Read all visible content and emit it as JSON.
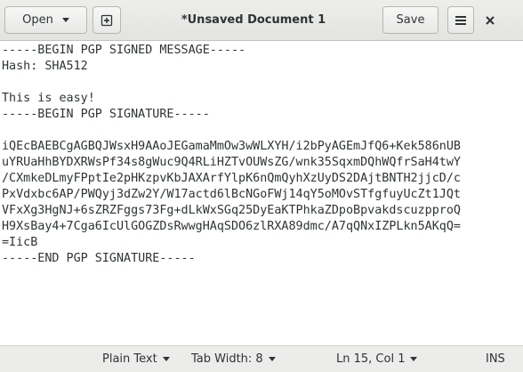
{
  "header": {
    "open_label": "Open",
    "title": "*Unsaved Document 1",
    "save_label": "Save",
    "icons": {
      "new": "new-document-icon",
      "menu": "hamburger-menu-icon",
      "close": "close-icon",
      "dropdown": "chevron-down-icon"
    }
  },
  "editor": {
    "lines": [
      "-----BEGIN PGP SIGNED MESSAGE-----",
      "Hash: SHA512",
      "",
      "This is easy!",
      "-----BEGIN PGP SIGNATURE-----",
      "",
      "iQEcBAEBCgAGBQJWsxH9AAoJEGamaMmOw3wWLXYH/i2bPyAGEmJfQ6+Kek586nUB",
      "uYRUaHhBYDXRWsPf34s8gWuc9Q4RLiHZTvOUWsZG/wnk35SqxmDQhWQfrSaH4twY",
      "/CXmkeDLmyFPptIe2pHKzpvKbJAXArfYlpK6nQmQyhXzUyDS2DAjtBNTH2jjcD/c",
      "PxVdxbc6AP/PWQyj3dZw2Y/W17actd6lBcNGoFWj14qY5oMOvSTfgfuyUcZt1JQt",
      "VFxXg3HgNJ+6sZRZFggs73Fg+dLkWxSGq25DyEaKTPhkaZDpoBpvakdscuzpproQ",
      "H9XsBay4+7Cga6IcUlGOGZDsRwwgHAqSDO6zlRXA89dmc/A7qQNxIZPLkn5AKqQ=",
      "=IicB",
      "-----END PGP SIGNATURE-----"
    ]
  },
  "statusbar": {
    "language": "Plain Text",
    "tab_width": "Tab Width: 8",
    "position": "Ln 15, Col 1",
    "mode": "INS"
  }
}
